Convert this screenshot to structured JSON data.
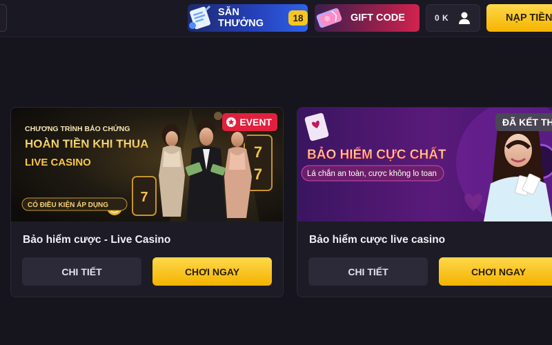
{
  "header": {
    "hunt_label": "SĂN THƯỞNG",
    "hunt_count": "18",
    "gift_label": "GIFT CODE",
    "balance": "0 K",
    "deposit_label": "NẠP TIỀN"
  },
  "cards": [
    {
      "tag": "EVENT",
      "banner": {
        "line1": "CHƯƠNG TRÌNH BẢO CHỨNG",
        "line2": "HOÀN TIỀN KHI THUA",
        "line3": "LIVE CASINO",
        "line4": "CÓ ĐIỀU KIỆN ÁP DỤNG"
      },
      "title": "Bảo hiểm cược - Live Casino",
      "detail_label": "CHI TIẾT",
      "play_label": "CHƠI NGAY"
    },
    {
      "tag": "ĐÃ KẾT THÚC",
      "banner": {
        "line1": "BẢO HIỂM CỰC CHẤT",
        "line2": "Lá chắn an toàn, cược không lo toan"
      },
      "title": "Bảo hiểm cược live casino",
      "detail_label": "CHI TIẾT",
      "play_label": "CHƠI NGAY"
    }
  ],
  "colors": {
    "background": "#16141d",
    "card": "#1d1b25",
    "accent_yellow": "#f6c521",
    "event_red": "#e0213e"
  }
}
